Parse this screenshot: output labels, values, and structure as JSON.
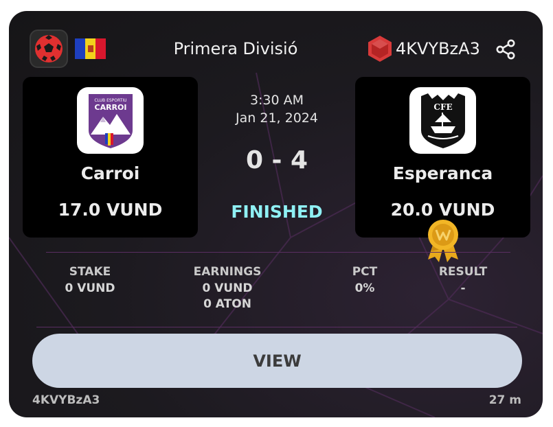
{
  "header": {
    "sport_icon": "soccer-ball-icon",
    "country_flag": "andorra-flag",
    "league": "Primera Divisió",
    "match_id": "4KVYBzA3",
    "share_icon": "share-icon"
  },
  "home": {
    "name": "Carroi",
    "odds": "17.0 VUND",
    "logo_text": "CLUB ESPORTIU",
    "logo_name": "CARROI"
  },
  "away": {
    "name": "Esperanca",
    "odds": "20.0 VUND",
    "logo_text": "CFE",
    "winner_icon": "gold-medal-icon"
  },
  "match": {
    "time": "3:30 AM",
    "date": "Jan 21, 2024",
    "score": "0 - 4",
    "status": "FINISHED"
  },
  "stats": {
    "stake_label": "STAKE",
    "stake_value": "0 VUND",
    "earnings_label": "EARNINGS",
    "earnings_vund": "0 VUND",
    "earnings_aton": "0 ATON",
    "pct_label": "PCT",
    "pct_value": "0%",
    "result_label": "RESULT",
    "result_value": "-"
  },
  "actions": {
    "view_label": "VIEW"
  },
  "footer": {
    "id": "4KVYBzA3",
    "age": "27 m"
  },
  "colors": {
    "status": "#8ff0f4",
    "button": "#cdd6e4",
    "hex": "#d83a3a",
    "medal": "#e8a91c"
  }
}
